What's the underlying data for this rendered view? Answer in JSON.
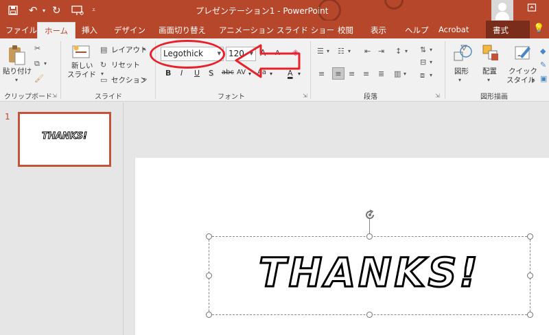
{
  "window": {
    "title": "プレゼンテーション1  -  PowerPoint"
  },
  "tabs": [
    {
      "label": "ファイル"
    },
    {
      "label": "ホーム"
    },
    {
      "label": "挿入"
    },
    {
      "label": "デザイン"
    },
    {
      "label": "画面切り替え"
    },
    {
      "label": "アニメーション"
    },
    {
      "label": "スライド ショー"
    },
    {
      "label": "校閲"
    },
    {
      "label": "表示"
    },
    {
      "label": "ヘルプ"
    },
    {
      "label": "Acrobat"
    },
    {
      "label": "書式"
    }
  ],
  "ribbon": {
    "clipboard": {
      "paste": "貼り付け",
      "group": "クリップボード"
    },
    "slides": {
      "new_slide_1": "新しい",
      "new_slide_2": "スライド",
      "layout": "レイアウト",
      "reset": "リセット",
      "section": "セクション",
      "group": "スライド"
    },
    "font": {
      "font_name": "Legothick",
      "font_size": "120",
      "group": "フォント",
      "bold": "B",
      "italic": "I",
      "underline": "U",
      "shadow": "S",
      "strikethrough": "abc",
      "spacing": "AV",
      "change_case": "Aa",
      "grow": "A",
      "shrink": "A",
      "color": "A"
    },
    "paragraph": {
      "group": "段落"
    },
    "drawing": {
      "shapes": "図形",
      "arrange": "配置",
      "quick_styles_1": "クイック",
      "quick_styles_2": "スタイル",
      "group": "図形描画"
    }
  },
  "slides_panel": {
    "slide_number": "1",
    "thumbnail_text": "THANKS!"
  },
  "canvas": {
    "text": "THANKS!"
  },
  "colors": {
    "accent": "#b7472a",
    "annotation": "#e8202a"
  }
}
